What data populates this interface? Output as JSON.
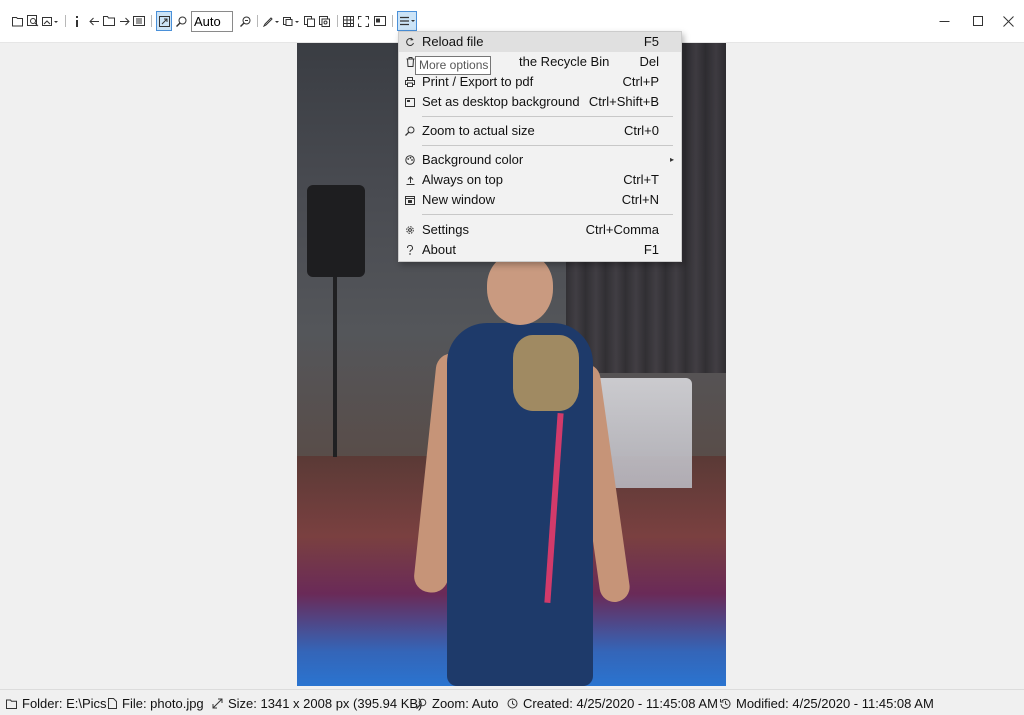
{
  "toolbar": {
    "zoom_value": "Auto",
    "tools": [
      "folder-open-icon",
      "find-icon",
      "image-dropdown-icon",
      "info-icon",
      "arrow-left-icon",
      "folder-icon",
      "arrow-right-icon",
      "slideshow-icon",
      "auto-fit-icon",
      "zoom-icon",
      "zoom-menu-icon",
      "edit-icon",
      "crop-icon",
      "copy-icon",
      "clone-icon",
      "grid-icon",
      "fullscreen-icon",
      "gallery-icon",
      "more-options-icon"
    ]
  },
  "tooltip": {
    "text": "More options"
  },
  "menu": {
    "items": [
      {
        "label": "Reload file",
        "shortcut": "F5",
        "icon": "reload-icon"
      },
      {
        "label": "the Recycle Bin",
        "shortcut": "Del",
        "icon": "trash-icon"
      },
      {
        "label": "Print / Export to pdf",
        "shortcut": "Ctrl+P",
        "icon": "print-icon"
      },
      {
        "label": "Set as desktop background",
        "shortcut": "Ctrl+Shift+B",
        "icon": "desktop-icon"
      },
      {
        "label": "Zoom to actual size",
        "shortcut": "Ctrl+0",
        "icon": "zoom-icon"
      },
      {
        "label": "Background color",
        "shortcut": "",
        "icon": "palette-icon"
      },
      {
        "label": "Always on top",
        "shortcut": "Ctrl+T",
        "icon": "pin-top-icon"
      },
      {
        "label": "New window",
        "shortcut": "Ctrl+N",
        "icon": "window-icon"
      },
      {
        "label": "Settings",
        "shortcut": "Ctrl+Comma",
        "icon": "gear-icon"
      },
      {
        "label": "About",
        "shortcut": "F1",
        "icon": "question-icon"
      }
    ]
  },
  "status": {
    "folder": "Folder: E:\\Pics",
    "file": "File: photo.jpg",
    "size": "Size: 1341 x 2008 px (395.94 KB)",
    "zoom": "Zoom: Auto",
    "created": "Created: 4/25/2020 - 11:45:08 AM",
    "modified": "Modified: 4/25/2020 - 11:45:08 AM"
  },
  "colors": {
    "accent": "#4a90d9",
    "menu_bg": "#f2f2f2",
    "menu_highlight": "#e0e0e0"
  }
}
